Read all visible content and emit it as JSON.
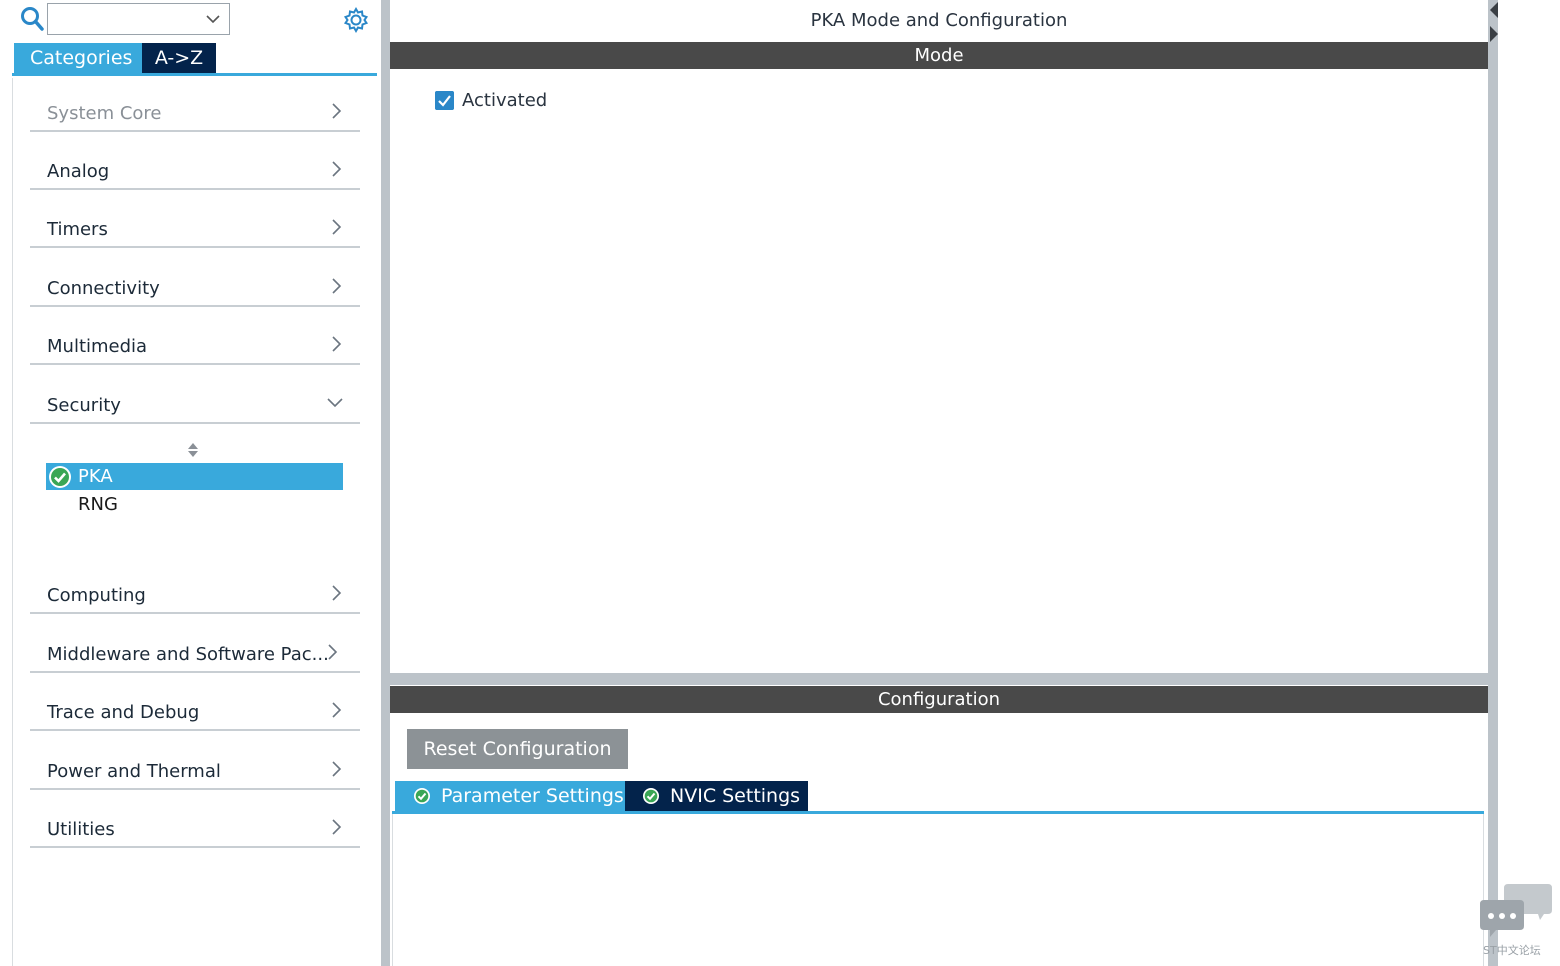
{
  "search": {
    "value": ""
  },
  "tabs": {
    "categories": "Categories",
    "atoz": "A->Z"
  },
  "categories": [
    {
      "label": "System Core"
    },
    {
      "label": "Analog"
    },
    {
      "label": "Timers"
    },
    {
      "label": "Connectivity"
    },
    {
      "label": "Multimedia"
    },
    {
      "label": "Security",
      "expanded": true,
      "items": [
        {
          "label": "PKA",
          "selected": true,
          "status": "enabled"
        },
        {
          "label": "RNG"
        }
      ]
    },
    {
      "label": "Computing"
    },
    {
      "label": "Middleware and Software Pac..."
    },
    {
      "label": "Trace and Debug"
    },
    {
      "label": "Power and Thermal"
    },
    {
      "label": "Utilities"
    }
  ],
  "panel": {
    "title": "PKA Mode and Configuration",
    "mode_header": "Mode",
    "activated_label": "Activated",
    "activated_checked": true,
    "config_header": "Configuration",
    "reset_button": "Reset Configuration",
    "config_tabs": [
      {
        "label": "Parameter Settings",
        "active": true
      },
      {
        "label": "NVIC Settings",
        "active": false
      }
    ]
  },
  "forum": {
    "caption": "ST中文论坛"
  },
  "colors": {
    "accent": "#39a9dc",
    "navy": "#03234b",
    "header": "#494949",
    "button": "#8c9296",
    "check_green": "#3aa655"
  }
}
